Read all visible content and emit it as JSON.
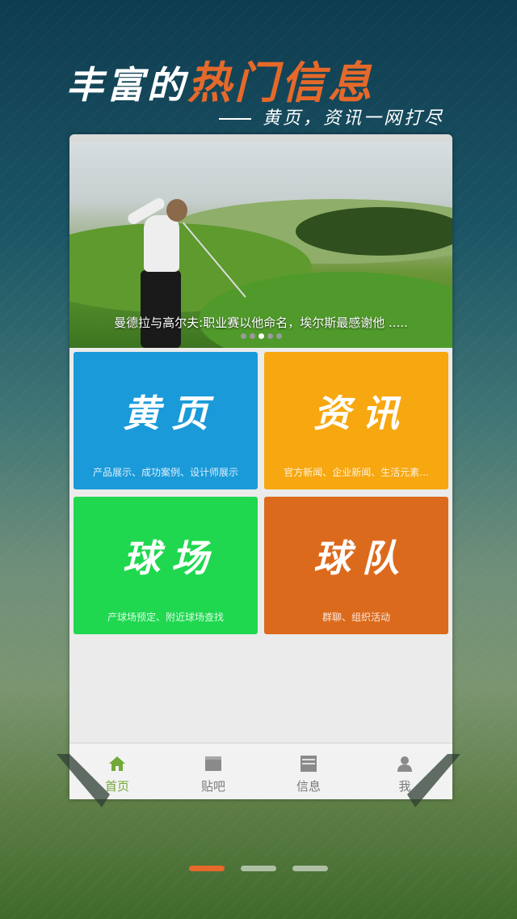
{
  "headline": {
    "part1": "丰富的",
    "part2": "热门信息",
    "subtitle": "黄页，资讯一网打尽"
  },
  "hero": {
    "caption": "曼德拉与高尔夫:职业赛以他命名，埃尔斯最感谢他 .....",
    "dot_count": 5,
    "active_dot": 2
  },
  "tiles": [
    {
      "title": "黄页",
      "subtitle": "产品展示、成功案例、设计师展示",
      "color": "#1a9ad9"
    },
    {
      "title": "资讯",
      "subtitle": "官方新闻、企业新闻、生活元素...",
      "color": "#f7a70f"
    },
    {
      "title": "球场",
      "subtitle": "产球场预定、附近球场查找",
      "color": "#1fd84f"
    },
    {
      "title": "球队",
      "subtitle": "群聊、组织活动",
      "color": "#dc6a1c"
    }
  ],
  "tabbar": {
    "items": [
      {
        "label": "首页",
        "icon": "home-icon",
        "active": true
      },
      {
        "label": "贴吧",
        "icon": "forum-icon",
        "active": false
      },
      {
        "label": "信息",
        "icon": "news-icon",
        "active": false
      },
      {
        "label": "我",
        "icon": "user-icon",
        "active": false
      }
    ],
    "active_color": "#73a83a"
  },
  "pager": {
    "count": 3,
    "active_index": 0,
    "active_color": "#e5692a"
  }
}
